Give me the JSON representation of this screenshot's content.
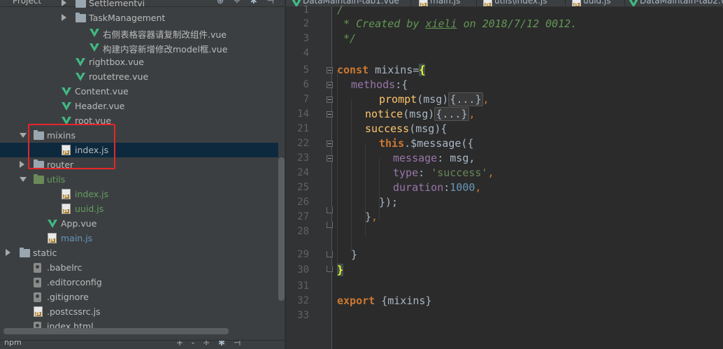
{
  "project_panel": {
    "title": "Project",
    "header_icons": [
      "⊕",
      "÷",
      "✱",
      "⊣"
    ],
    "tree": [
      {
        "label": "Settlementvi",
        "icon": "folder",
        "arrow": "right",
        "color": "default"
      },
      {
        "label": "TaskManagement",
        "icon": "folder",
        "arrow": "right",
        "color": "default"
      },
      {
        "label": "右侧表格容器请复制改组件.vue",
        "icon": "vue",
        "arrow": "",
        "color": "default"
      },
      {
        "label": "构建内容新增修改model框.vue",
        "icon": "vue",
        "arrow": "",
        "color": "default"
      },
      {
        "label": "rightbox.vue",
        "icon": "vue",
        "arrow": "",
        "color": "default"
      },
      {
        "label": "routetree.vue",
        "icon": "vue",
        "arrow": "",
        "color": "default"
      },
      {
        "label": "Content.vue",
        "icon": "vue",
        "arrow": "",
        "color": "default"
      },
      {
        "label": "Header.vue",
        "icon": "vue",
        "arrow": "",
        "color": "default"
      },
      {
        "label": "root.vue",
        "icon": "vue",
        "arrow": "",
        "color": "default"
      },
      {
        "label": "mixins",
        "icon": "folder",
        "arrow": "down",
        "color": "default"
      },
      {
        "label": "index.js",
        "icon": "js",
        "arrow": "",
        "color": "default",
        "selected": true
      },
      {
        "label": "router",
        "icon": "folder",
        "arrow": "right",
        "color": "default"
      },
      {
        "label": "utils",
        "icon": "folder-green",
        "arrow": "down",
        "color": "green"
      },
      {
        "label": "index.js",
        "icon": "js",
        "arrow": "",
        "color": "green"
      },
      {
        "label": "uuid.js",
        "icon": "js",
        "arrow": "",
        "color": "green"
      },
      {
        "label": "App.vue",
        "icon": "vue",
        "arrow": "",
        "color": "default"
      },
      {
        "label": "main.js",
        "icon": "js",
        "arrow": "",
        "color": "blue"
      },
      {
        "label": "static",
        "icon": "folder",
        "arrow": "right",
        "color": "default"
      },
      {
        "label": ".babelrc",
        "icon": "cfg",
        "arrow": "",
        "color": "default"
      },
      {
        "label": ".editorconfig",
        "icon": "cfg",
        "arrow": "",
        "color": "default"
      },
      {
        "label": ".gitignore",
        "icon": "cfg",
        "arrow": "",
        "color": "default"
      },
      {
        "label": ".postcssrc.js",
        "icon": "js",
        "arrow": "",
        "color": "default"
      },
      {
        "label": "index.html",
        "icon": "cfg",
        "arrow": "",
        "color": "default"
      }
    ],
    "footer_label": "npm",
    "footer_icons": [
      "+",
      "-",
      "÷",
      "✱",
      "⊣"
    ]
  },
  "editor_tabs": [
    {
      "label": "DataMaintain-tab1.vue",
      "icon": "vue"
    },
    {
      "label": "main.js",
      "icon": "js"
    },
    {
      "label": "utils\\index.js",
      "icon": "js"
    },
    {
      "label": "uuid.js",
      "icon": "js"
    },
    {
      "label": "DataMaintain-tab2.vu",
      "icon": "vue"
    }
  ],
  "line_numbers": [
    "1",
    "2",
    "3",
    "4",
    "5",
    "6",
    "7",
    "14",
    "21",
    "22",
    "23",
    "24",
    "25",
    "26",
    "27",
    "28",
    "29",
    "30",
    "31",
    "32",
    "33"
  ],
  "code": {
    "l1": "/",
    "l2_prefix": " * Created by ",
    "l2_author": "xieli",
    "l2_suffix": " on 2018/7/12 0012.",
    "l3": " */",
    "l5_kw": "const",
    "l5_name": " mixins",
    "l5_eq": "=",
    "l5_brace": "{",
    "l6_prop": "methods",
    "l6_rest": ":{",
    "l7_fn": "prompt",
    "l7_args": "(msg)",
    "l7_fold": "{...}",
    "l7_comma": ",",
    "l8_fn": "notice",
    "l8_args": "(msg)",
    "l8_fold": "{...}",
    "l8_comma": ",",
    "l9_fn": "success",
    "l9_args": "(msg){",
    "l10_this": "this",
    "l10_rest": ".$message({",
    "l11_prop": "message",
    "l11_rest": ": msg,",
    "l12_prop": "type",
    "l12_colon": ": ",
    "l12_str": "'success'",
    "l12_comma": ",",
    "l13_prop": "duration",
    "l13_colon": ":",
    "l13_num": "1000",
    "l13_comma": ",",
    "l14": "});",
    "l15_close": "}",
    "l15_comma": ",",
    "l17": "}",
    "l18": "}",
    "l20_kw": "export",
    "l20_rest": " {mixins}"
  }
}
